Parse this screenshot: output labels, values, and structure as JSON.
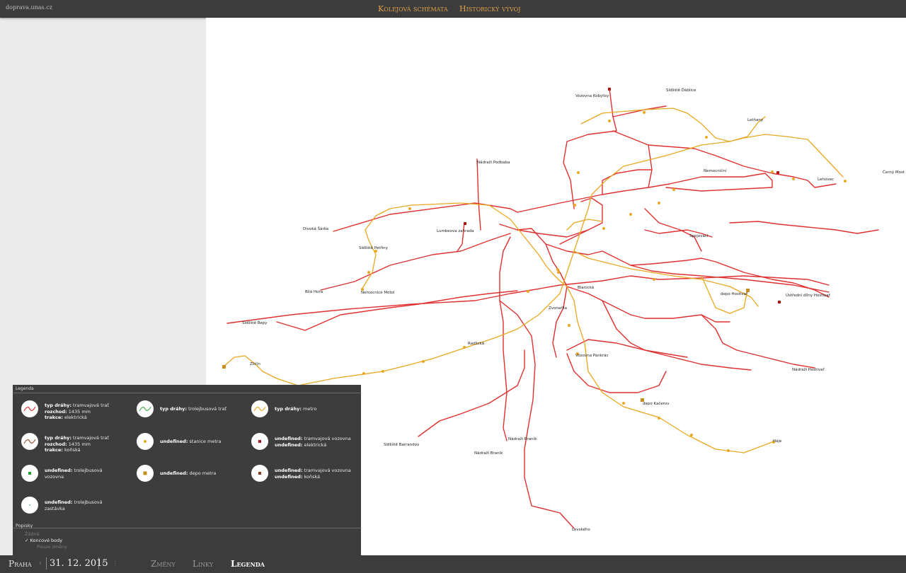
{
  "header": {
    "site": "doprava.unas.cz",
    "nav": [
      "Kolejová schémata",
      "Historický vývoj"
    ]
  },
  "colors": {
    "tram": "#e03030",
    "metro": "#e8a820",
    "bar": "#3c3c3c",
    "accent": "#e0a24a"
  },
  "map": {
    "labels": {
      "vozovna_kobylisy": "Vozovna Kobylisy",
      "sidliste_dablice": "Sídliště Ďáblice",
      "letnany": "Letňany",
      "nadrazi_podbaba": "Nádraží Podbaba",
      "nemocnicni": "Nemocniční",
      "lehovec": "Lehovec",
      "cerny_most": "Černý Most",
      "divoka_sarka": "Divoká Šárka",
      "lumbeova": "Lumbeova zahrada",
      "sidliste_petriny": "Sídliště Petřiny",
      "spojovaci": "Spojovací",
      "bila_hora": "Bílá Hora",
      "nemocnice_motol": "Nemocnice Motol",
      "blanicka": "Blanická",
      "depo_hostivar": "depo Hostivař",
      "ustredni_dilny": "Ústřední dílny Hostivař",
      "zvonarka": "Zvonařka",
      "sidliste_repy": "Sídliště Řepy",
      "radlicka": "Radlická",
      "vozovna_pankrac": "Vozovna Pankrác",
      "zlicin": "Zličín",
      "nadrazi_hostivar": "Nádraží Hostivař",
      "depo_kacerov": "depo Kačerov",
      "sidliste_barrandov": "Sídliště Barrandov",
      "nadrazi_branik_1": "Nádraží Braník",
      "nadrazi_branik_2": "Nádraží Braník",
      "haje": "Háje",
      "levskeho": "Levského"
    }
  },
  "legend": {
    "title": "Legenda",
    "items": [
      {
        "l1k": "typ dráhy:",
        "l1v": "tramvajová trať",
        "l2k": "rozchod:",
        "l2v": "1435 mm",
        "l3k": "trakce:",
        "l3v": "elektrická"
      },
      {
        "l1k": "typ dráhy:",
        "l1v": "trolejbusová trať"
      },
      {
        "l1k": "typ dráhy:",
        "l1v": "metro"
      },
      {
        "l1k": "typ dráhy:",
        "l1v": "tramvajová trať",
        "l2k": "rozchod:",
        "l2v": "1435 mm",
        "l3k": "trakce:",
        "l3v": "koňská"
      },
      {
        "l1k": "undefined:",
        "l1v": "stanice metra"
      },
      {
        "l1k": "undefined:",
        "l1v": "tramvajová vozovna",
        "l2k": "undefined:",
        "l2v": "elektrická"
      },
      {
        "l1k": "undefined:",
        "l1v": "trolejbusová",
        "l2v": "vozovna"
      },
      {
        "l1k": "undefined:",
        "l1v": "depo metra"
      },
      {
        "l1k": "undefined:",
        "l1v": "tramvajová vozovna",
        "l2k": "undefined:",
        "l2v": "koňská"
      },
      {
        "l1k": "undefined:",
        "l1v": "trolejbusová",
        "l2v": "zastávka"
      }
    ],
    "popisky_title": "Popisky",
    "options": [
      {
        "label": "Žádné",
        "check": ""
      },
      {
        "label": "Koncové body",
        "check": "✓"
      },
      {
        "label": "Pouze změny",
        "check": ""
      }
    ]
  },
  "footer": {
    "city": "Praha",
    "prev": "‹",
    "date": "31. 12. 2015",
    "next": "›",
    "more": "⋮",
    "tabs": [
      "Změny",
      "Linky",
      "Legenda"
    ]
  }
}
